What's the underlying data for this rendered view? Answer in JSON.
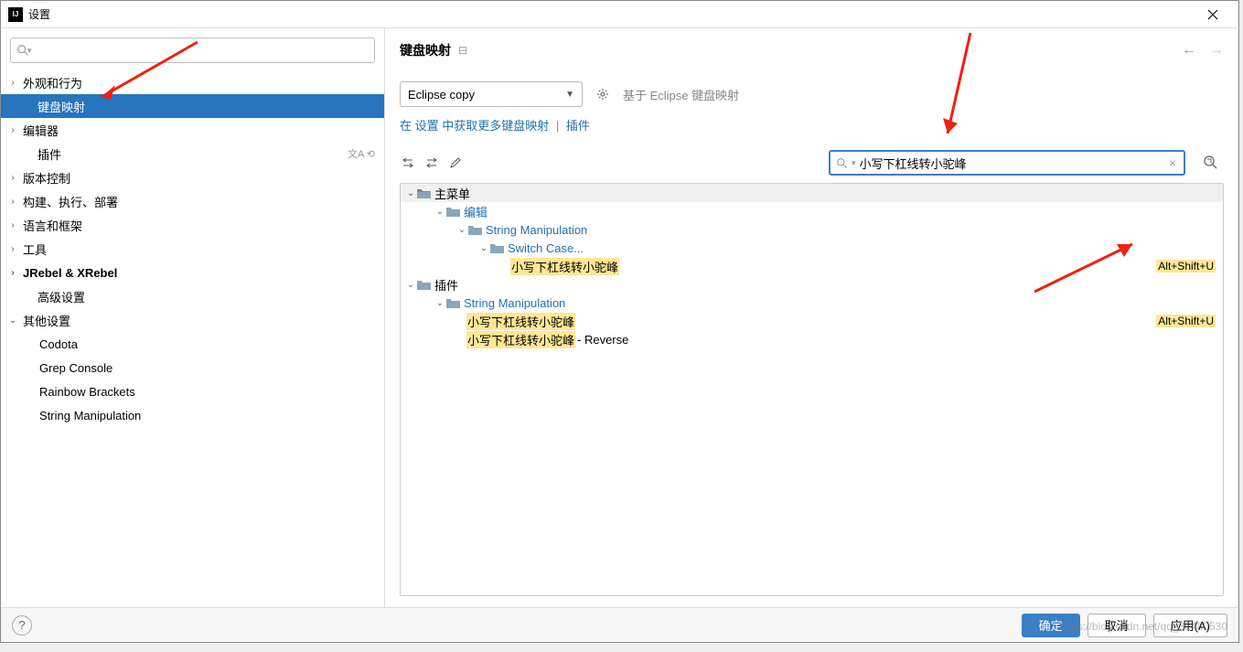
{
  "window": {
    "title": "设置"
  },
  "sidebar": {
    "search_placeholder": "",
    "items": [
      {
        "label": "外观和行为",
        "chev": true,
        "indent": 0
      },
      {
        "label": "键盘映射",
        "chev": false,
        "indent": 1,
        "selected": true
      },
      {
        "label": "编辑器",
        "chev": true,
        "indent": 0
      },
      {
        "label": "插件",
        "chev": false,
        "indent": 1,
        "extras": true
      },
      {
        "label": "版本控制",
        "chev": true,
        "indent": 0
      },
      {
        "label": "构建、执行、部署",
        "chev": true,
        "indent": 0
      },
      {
        "label": "语言和框架",
        "chev": true,
        "indent": 0
      },
      {
        "label": "工具",
        "chev": true,
        "indent": 0
      },
      {
        "label": "JRebel & XRebel",
        "chev": true,
        "indent": 0,
        "bold": true
      },
      {
        "label": "高级设置",
        "chev": false,
        "indent": 1
      },
      {
        "label": "其他设置",
        "chev": true,
        "indent": 0,
        "open": true
      },
      {
        "label": "Codota",
        "chev": false,
        "indent": 2
      },
      {
        "label": "Grep Console",
        "chev": false,
        "indent": 2
      },
      {
        "label": "Rainbow Brackets",
        "chev": false,
        "indent": 2
      },
      {
        "label": "String Manipulation",
        "chev": false,
        "indent": 2
      }
    ]
  },
  "main": {
    "title": "键盘映射",
    "keymap_selected": "Eclipse copy",
    "base_text": "基于 Eclipse 键盘映射",
    "link_text": "在 设置 中获取更多键盘映射",
    "link_sep": "|",
    "link_text2": "插件",
    "search_value": "小写下杠线转小驼峰"
  },
  "tree": {
    "root": "主菜单",
    "edit": "编辑",
    "sm": "String Manipulation",
    "switch": "Switch Case...",
    "action1": "小写下杠线转小驼峰",
    "plugins": "插件",
    "reverse_suffix": " - Reverse",
    "shortcut": "Alt+Shift+U"
  },
  "footer": {
    "ok": "确定",
    "cancel": "取消",
    "apply": "应用(A)"
  },
  "watermark": "https://blog.csdn.net/qq_31480530"
}
